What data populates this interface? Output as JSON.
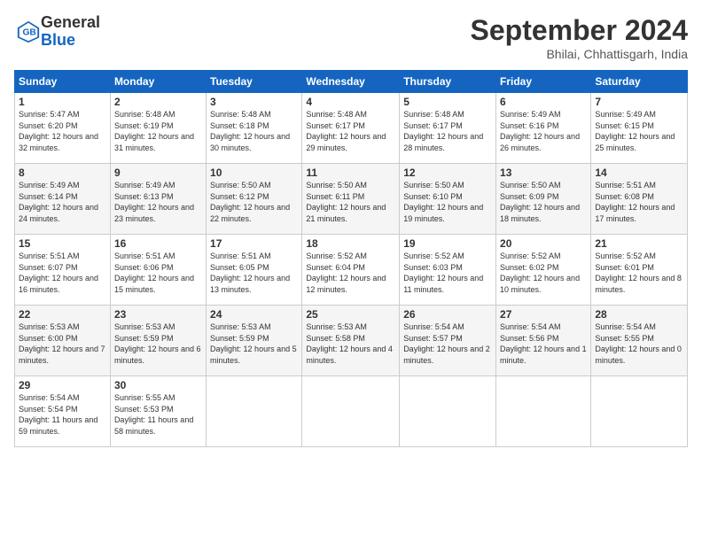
{
  "header": {
    "logo_general": "General",
    "logo_blue": "Blue",
    "month_title": "September 2024",
    "location": "Bhilai, Chhattisgarh, India"
  },
  "weekdays": [
    "Sunday",
    "Monday",
    "Tuesday",
    "Wednesday",
    "Thursday",
    "Friday",
    "Saturday"
  ],
  "weeks": [
    [
      {
        "day": "1",
        "sunrise": "5:47 AM",
        "sunset": "6:20 PM",
        "daylight": "12 hours and 32 minutes."
      },
      {
        "day": "2",
        "sunrise": "5:48 AM",
        "sunset": "6:19 PM",
        "daylight": "12 hours and 31 minutes."
      },
      {
        "day": "3",
        "sunrise": "5:48 AM",
        "sunset": "6:18 PM",
        "daylight": "12 hours and 30 minutes."
      },
      {
        "day": "4",
        "sunrise": "5:48 AM",
        "sunset": "6:17 PM",
        "daylight": "12 hours and 29 minutes."
      },
      {
        "day": "5",
        "sunrise": "5:48 AM",
        "sunset": "6:17 PM",
        "daylight": "12 hours and 28 minutes."
      },
      {
        "day": "6",
        "sunrise": "5:49 AM",
        "sunset": "6:16 PM",
        "daylight": "12 hours and 26 minutes."
      },
      {
        "day": "7",
        "sunrise": "5:49 AM",
        "sunset": "6:15 PM",
        "daylight": "12 hours and 25 minutes."
      }
    ],
    [
      {
        "day": "8",
        "sunrise": "5:49 AM",
        "sunset": "6:14 PM",
        "daylight": "12 hours and 24 minutes."
      },
      {
        "day": "9",
        "sunrise": "5:49 AM",
        "sunset": "6:13 PM",
        "daylight": "12 hours and 23 minutes."
      },
      {
        "day": "10",
        "sunrise": "5:50 AM",
        "sunset": "6:12 PM",
        "daylight": "12 hours and 22 minutes."
      },
      {
        "day": "11",
        "sunrise": "5:50 AM",
        "sunset": "6:11 PM",
        "daylight": "12 hours and 21 minutes."
      },
      {
        "day": "12",
        "sunrise": "5:50 AM",
        "sunset": "6:10 PM",
        "daylight": "12 hours and 19 minutes."
      },
      {
        "day": "13",
        "sunrise": "5:50 AM",
        "sunset": "6:09 PM",
        "daylight": "12 hours and 18 minutes."
      },
      {
        "day": "14",
        "sunrise": "5:51 AM",
        "sunset": "6:08 PM",
        "daylight": "12 hours and 17 minutes."
      }
    ],
    [
      {
        "day": "15",
        "sunrise": "5:51 AM",
        "sunset": "6:07 PM",
        "daylight": "12 hours and 16 minutes."
      },
      {
        "day": "16",
        "sunrise": "5:51 AM",
        "sunset": "6:06 PM",
        "daylight": "12 hours and 15 minutes."
      },
      {
        "day": "17",
        "sunrise": "5:51 AM",
        "sunset": "6:05 PM",
        "daylight": "12 hours and 13 minutes."
      },
      {
        "day": "18",
        "sunrise": "5:52 AM",
        "sunset": "6:04 PM",
        "daylight": "12 hours and 12 minutes."
      },
      {
        "day": "19",
        "sunrise": "5:52 AM",
        "sunset": "6:03 PM",
        "daylight": "12 hours and 11 minutes."
      },
      {
        "day": "20",
        "sunrise": "5:52 AM",
        "sunset": "6:02 PM",
        "daylight": "12 hours and 10 minutes."
      },
      {
        "day": "21",
        "sunrise": "5:52 AM",
        "sunset": "6:01 PM",
        "daylight": "12 hours and 8 minutes."
      }
    ],
    [
      {
        "day": "22",
        "sunrise": "5:53 AM",
        "sunset": "6:00 PM",
        "daylight": "12 hours and 7 minutes."
      },
      {
        "day": "23",
        "sunrise": "5:53 AM",
        "sunset": "5:59 PM",
        "daylight": "12 hours and 6 minutes."
      },
      {
        "day": "24",
        "sunrise": "5:53 AM",
        "sunset": "5:59 PM",
        "daylight": "12 hours and 5 minutes."
      },
      {
        "day": "25",
        "sunrise": "5:53 AM",
        "sunset": "5:58 PM",
        "daylight": "12 hours and 4 minutes."
      },
      {
        "day": "26",
        "sunrise": "5:54 AM",
        "sunset": "5:57 PM",
        "daylight": "12 hours and 2 minutes."
      },
      {
        "day": "27",
        "sunrise": "5:54 AM",
        "sunset": "5:56 PM",
        "daylight": "12 hours and 1 minute."
      },
      {
        "day": "28",
        "sunrise": "5:54 AM",
        "sunset": "5:55 PM",
        "daylight": "12 hours and 0 minutes."
      }
    ],
    [
      {
        "day": "29",
        "sunrise": "5:54 AM",
        "sunset": "5:54 PM",
        "daylight": "11 hours and 59 minutes."
      },
      {
        "day": "30",
        "sunrise": "5:55 AM",
        "sunset": "5:53 PM",
        "daylight": "11 hours and 58 minutes."
      },
      null,
      null,
      null,
      null,
      null
    ]
  ]
}
